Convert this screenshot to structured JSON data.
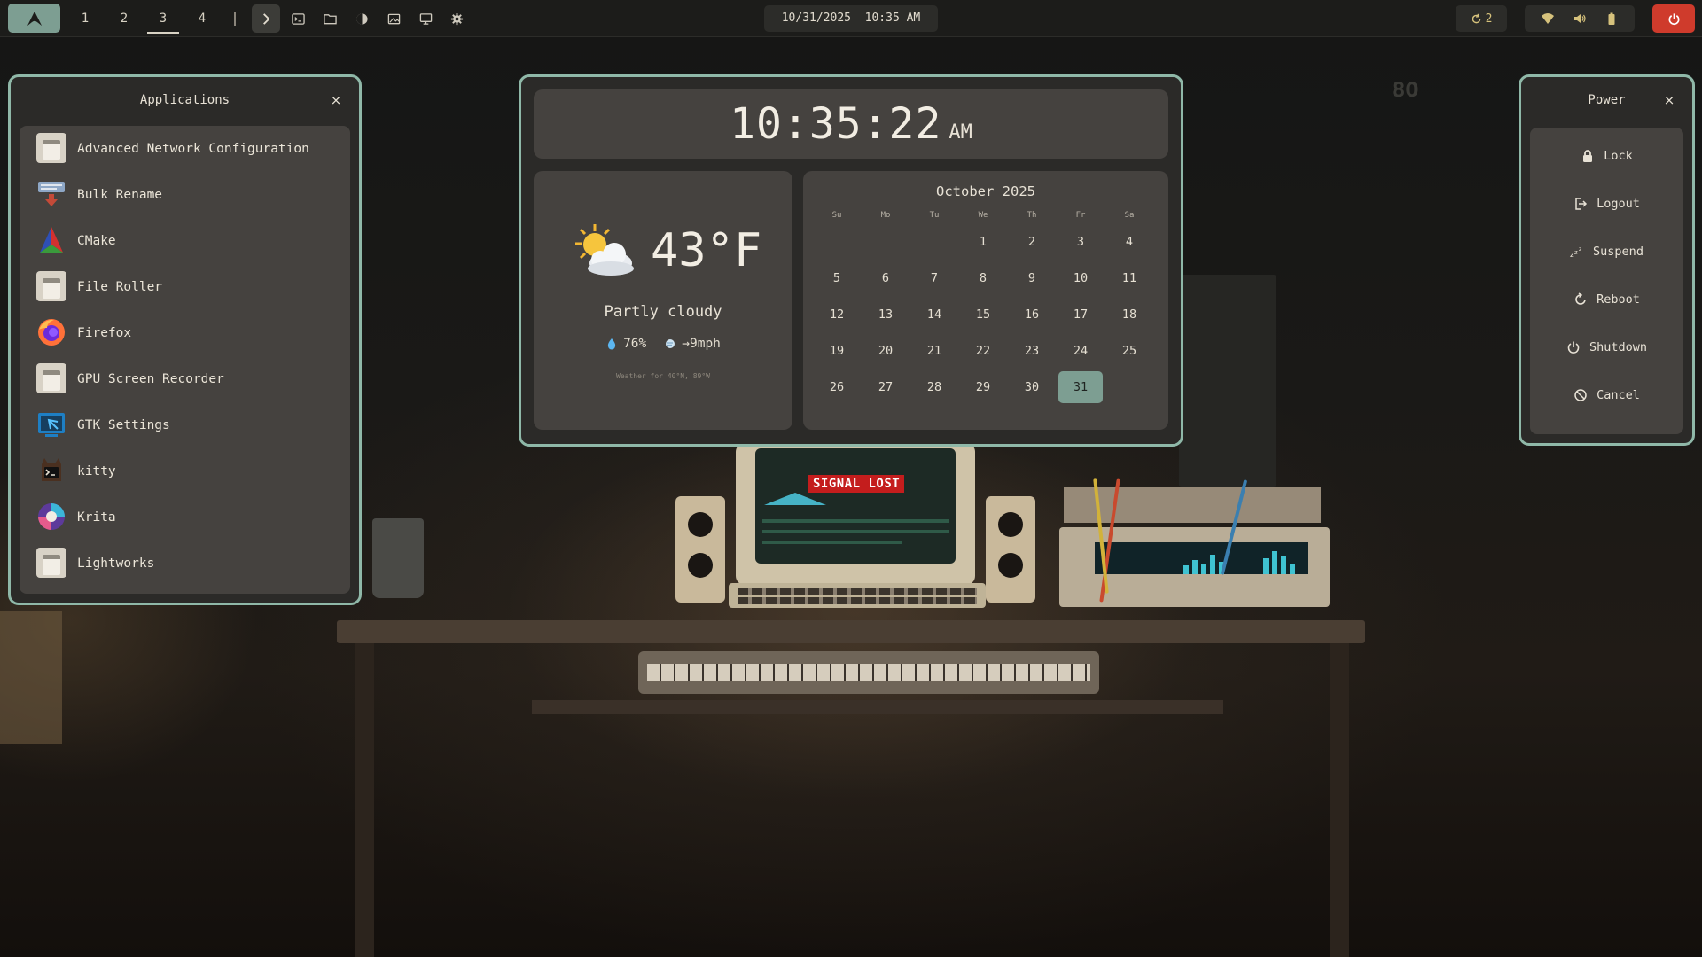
{
  "topbar": {
    "workspaces": [
      "1",
      "2",
      "3",
      "4"
    ],
    "active_workspace": "3",
    "clock": "10/31/2025  10:35 AM",
    "updates_count": "2",
    "icons": [
      "arch-logo-icon",
      "chevron-right-icon",
      "terminal-icon",
      "folder-icon",
      "theme-icon",
      "image-icon",
      "monitor-icon",
      "gear-icon",
      "update-icon",
      "wifi-icon",
      "volume-icon",
      "battery-icon",
      "power-icon"
    ]
  },
  "wallpaper": {
    "sign": "SIGNAL LOST",
    "poster_number": "80"
  },
  "apps_panel": {
    "title": "Applications",
    "close": "×",
    "items": [
      {
        "label": "Advanced Network Configuration",
        "icon": "window-icon"
      },
      {
        "label": "Bulk Rename",
        "icon": "bulk-rename-icon"
      },
      {
        "label": "CMake",
        "icon": "cmake-icon"
      },
      {
        "label": "File Roller",
        "icon": "window-icon"
      },
      {
        "label": "Firefox",
        "icon": "firefox-icon"
      },
      {
        "label": "GPU Screen Recorder",
        "icon": "window-icon"
      },
      {
        "label": "GTK Settings",
        "icon": "gtk-settings-icon"
      },
      {
        "label": "kitty",
        "icon": "kitty-icon"
      },
      {
        "label": "Krita",
        "icon": "krita-icon"
      },
      {
        "label": "Lightworks",
        "icon": "window-icon"
      }
    ]
  },
  "clock_panel": {
    "time": "10:35:22",
    "ampm": "AM"
  },
  "weather": {
    "temp": "43°F",
    "condition": "Partly cloudy",
    "humidity": "76%",
    "wind": "→9mph",
    "footer": "Weather for 40°N, 89°W",
    "icon": "partly-cloudy-icon"
  },
  "calendar": {
    "title": "October 2025",
    "weekdays": [
      "Su",
      "Mo",
      "Tu",
      "We",
      "Th",
      "Fr",
      "Sa"
    ],
    "first_weekday_index": 3,
    "days_in_month": 31,
    "today": 31
  },
  "power_panel": {
    "title": "Power",
    "close": "×",
    "items": [
      {
        "label": "Lock",
        "icon": "lock-icon"
      },
      {
        "label": "Logout",
        "icon": "logout-icon"
      },
      {
        "label": "Suspend",
        "icon": "suspend-icon"
      },
      {
        "label": "Reboot",
        "icon": "reboot-icon"
      },
      {
        "label": "Shutdown",
        "icon": "shutdown-icon"
      },
      {
        "label": "Cancel",
        "icon": "cancel-icon"
      }
    ]
  },
  "colors": {
    "accent": "#8fb8a8",
    "accent_fill": "#7d9e92",
    "panel_bg": "#2b2a28",
    "card_bg": "#45423f",
    "power_red": "#cf3b2c"
  }
}
